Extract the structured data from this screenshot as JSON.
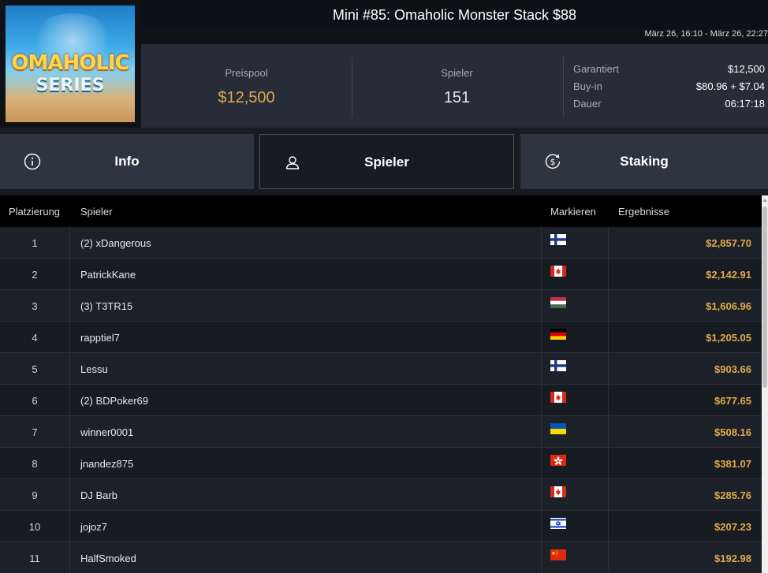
{
  "logo": {
    "line1": "OMAHOLIC",
    "line2": "SERIES"
  },
  "tournament": {
    "title": "Mini #85: Omaholic Monster Stack $88",
    "dates": "März 26, 16:10 - März 26, 22:27"
  },
  "stats": {
    "prizepool_label": "Preispool",
    "prizepool_value": "$12,500",
    "players_label": "Spieler",
    "players_value": "151",
    "guaranteed_label": "Garantiert",
    "guaranteed_value": "$12,500",
    "buyin_label": "Buy-in",
    "buyin_value": "$80.96 + $7.04",
    "duration_label": "Dauer",
    "duration_value": "06:17:18"
  },
  "tabs": [
    {
      "label": "Info",
      "icon": "info-icon",
      "active": false
    },
    {
      "label": "Spieler",
      "icon": "user-icon",
      "active": true
    },
    {
      "label": "Staking",
      "icon": "dollar-cycle-icon",
      "active": false
    }
  ],
  "table": {
    "headers": {
      "place": "Platzierung",
      "player": "Spieler",
      "flag": "Markieren",
      "result": "Ergebnisse"
    },
    "rows": [
      {
        "place": "1",
        "name": "(2) xDangerous",
        "flag": "finland",
        "result": "$2,857.70"
      },
      {
        "place": "2",
        "name": "PatrickKane",
        "flag": "canada",
        "result": "$2,142.91"
      },
      {
        "place": "3",
        "name": "(3) T3TR15",
        "flag": "hungary",
        "result": "$1,606.96"
      },
      {
        "place": "4",
        "name": "rapptiel7",
        "flag": "germany",
        "result": "$1,205.05"
      },
      {
        "place": "5",
        "name": "Lessu",
        "flag": "finland",
        "result": "$903.66"
      },
      {
        "place": "6",
        "name": "(2) BDPoker69",
        "flag": "canada",
        "result": "$677.65"
      },
      {
        "place": "7",
        "name": "winner0001",
        "flag": "ukraine",
        "result": "$508.16"
      },
      {
        "place": "8",
        "name": "jnandez875",
        "flag": "hongkong",
        "result": "$381.07"
      },
      {
        "place": "9",
        "name": "DJ Barb",
        "flag": "canada",
        "result": "$285.76"
      },
      {
        "place": "10",
        "name": "jojoz7",
        "flag": "israel",
        "result": "$207.23"
      },
      {
        "place": "11",
        "name": "HalfSmoked",
        "flag": "china",
        "result": "$192.98"
      }
    ]
  },
  "colors": {
    "accent_gold": "#e0a94a",
    "panel": "#262d38",
    "tab": "#2d3540",
    "background": "#171b22"
  }
}
